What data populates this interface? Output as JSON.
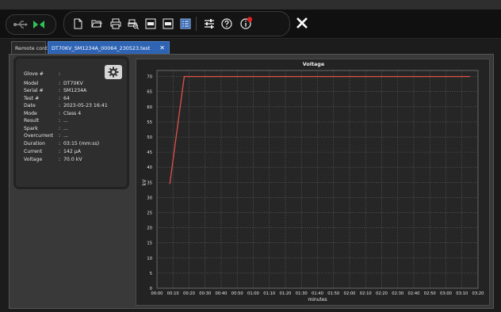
{
  "toolbar": {
    "close_label": "✕",
    "buttons": [
      "new-file-icon",
      "open-folder-icon",
      "print-icon",
      "print-preview-icon",
      "export-pdf-icon",
      "export-xls-icon",
      "report-view-icon",
      "settings-sliders-icon",
      "help-icon",
      "info-icon"
    ]
  },
  "tabs": [
    {
      "label": "Remote control"
    },
    {
      "label": "DT70KV_SM1234A_00064_230523.test",
      "close": "✕"
    }
  ],
  "info": {
    "rows": [
      {
        "key": "Glove #",
        "sep": ":",
        "value": ""
      },
      {
        "key": "Model",
        "sep": ":",
        "value": "DT70KV"
      },
      {
        "key": "Serial #",
        "sep": ":",
        "value": "SM1234A"
      },
      {
        "key": "Test #",
        "sep": ":",
        "value": "64"
      },
      {
        "key": "Date",
        "sep": ":",
        "value": "2023-05-23 16:41"
      },
      {
        "key": "Mode",
        "sep": ":",
        "value": "Class 4"
      },
      {
        "key": "Result",
        "sep": ":",
        "value": "..."
      },
      {
        "key": "Spark",
        "sep": ":",
        "value": "..."
      },
      {
        "key": "Overcurrent",
        "sep": ":",
        "value": "..."
      },
      {
        "key": "Duration",
        "sep": ":",
        "value": "03:15 (mm:ss)"
      },
      {
        "key": "Current",
        "sep": ":",
        "value": "142 µA"
      },
      {
        "key": "Voltage",
        "sep": ":",
        "value": "70.0 kV"
      }
    ]
  },
  "colors": {
    "line": "#e0504a",
    "tab_active": "#2f64b4",
    "status_ok": "#2ec45a",
    "badge": "#e02020"
  },
  "chart_data": {
    "type": "line",
    "title": "Voltage",
    "xlabel": "minutes",
    "ylabel": "kV",
    "ylim": [
      0,
      72
    ],
    "yticks": [
      0,
      5,
      10,
      15,
      20,
      25,
      30,
      35,
      40,
      45,
      50,
      55,
      60,
      65,
      70
    ],
    "xticks": [
      "00:00",
      "00:10",
      "00:20",
      "00:30",
      "00:40",
      "00:50",
      "01:00",
      "01:10",
      "01:20",
      "01:30",
      "01:40",
      "01:50",
      "02:00",
      "02:10",
      "02:20",
      "02:30",
      "02:40",
      "02:50",
      "03:00",
      "03:10",
      "03:20"
    ],
    "grid": true,
    "series": [
      {
        "x": [
          8,
          17,
          195
        ],
        "y": [
          34.5,
          70,
          70
        ]
      }
    ]
  }
}
